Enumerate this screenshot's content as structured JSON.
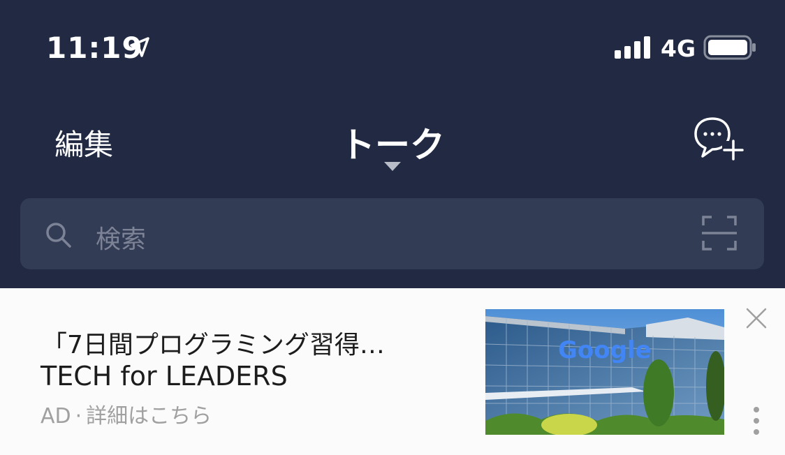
{
  "status_bar": {
    "time": "11:19",
    "network": "4G",
    "icons": [
      "location-arrow-icon",
      "signal-bars-icon",
      "battery-icon"
    ]
  },
  "nav": {
    "edit_label": "編集",
    "title": "トーク",
    "icons": [
      "chevron-down-icon",
      "new-chat-icon"
    ]
  },
  "search": {
    "placeholder": "検索",
    "icons": [
      "search-icon",
      "scan-icon"
    ]
  },
  "ad": {
    "title": "「7日間プログラミング習得…",
    "sponsor": "TECH for LEADERS",
    "badge": "AD",
    "separator": "·",
    "details_link": "詳細はこちら",
    "image_text": "Google",
    "icons": [
      "close-icon",
      "more-vertical-icon"
    ]
  },
  "colors": {
    "header_bg": "#212a42",
    "search_bg": "#333c55",
    "placeholder": "#7d8397",
    "ad_bg": "#fbfbfb",
    "ad_meta": "#a0a0a0"
  }
}
